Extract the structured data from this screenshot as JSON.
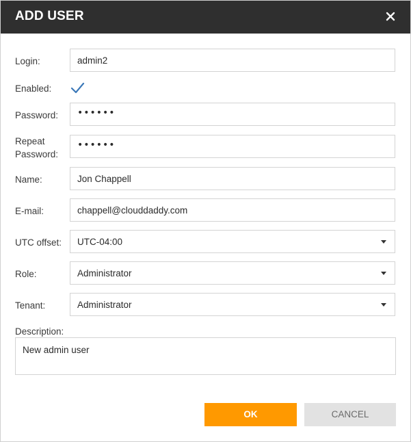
{
  "dialog": {
    "title": "ADD USER",
    "close_icon": "close-icon"
  },
  "form": {
    "login": {
      "label": "Login:",
      "value": "admin2"
    },
    "enabled": {
      "label": "Enabled:",
      "checked": true,
      "icon": "checkmark-icon"
    },
    "password": {
      "label": "Password:",
      "masked": "••••••"
    },
    "repeat_password": {
      "label_line1": "Repeat",
      "label_line2": "Password:",
      "masked": "••••••"
    },
    "name": {
      "label": "Name:",
      "value": "Jon Chappell"
    },
    "email": {
      "label": "E-mail:",
      "value": "chappell@clouddaddy.com"
    },
    "utc_offset": {
      "label": "UTC offset:",
      "value": "UTC-04:00"
    },
    "role": {
      "label": "Role:",
      "value": "Administrator"
    },
    "tenant": {
      "label": "Tenant:",
      "value": "Administrator"
    },
    "description": {
      "label": "Description:",
      "value": "New admin user"
    }
  },
  "buttons": {
    "ok": "OK",
    "cancel": "CANCEL"
  },
  "colors": {
    "titlebar": "#2f2f2f",
    "ok_button": "#ff9900",
    "cancel_button": "#e2e2e2",
    "checkmark": "#3b78b8"
  }
}
